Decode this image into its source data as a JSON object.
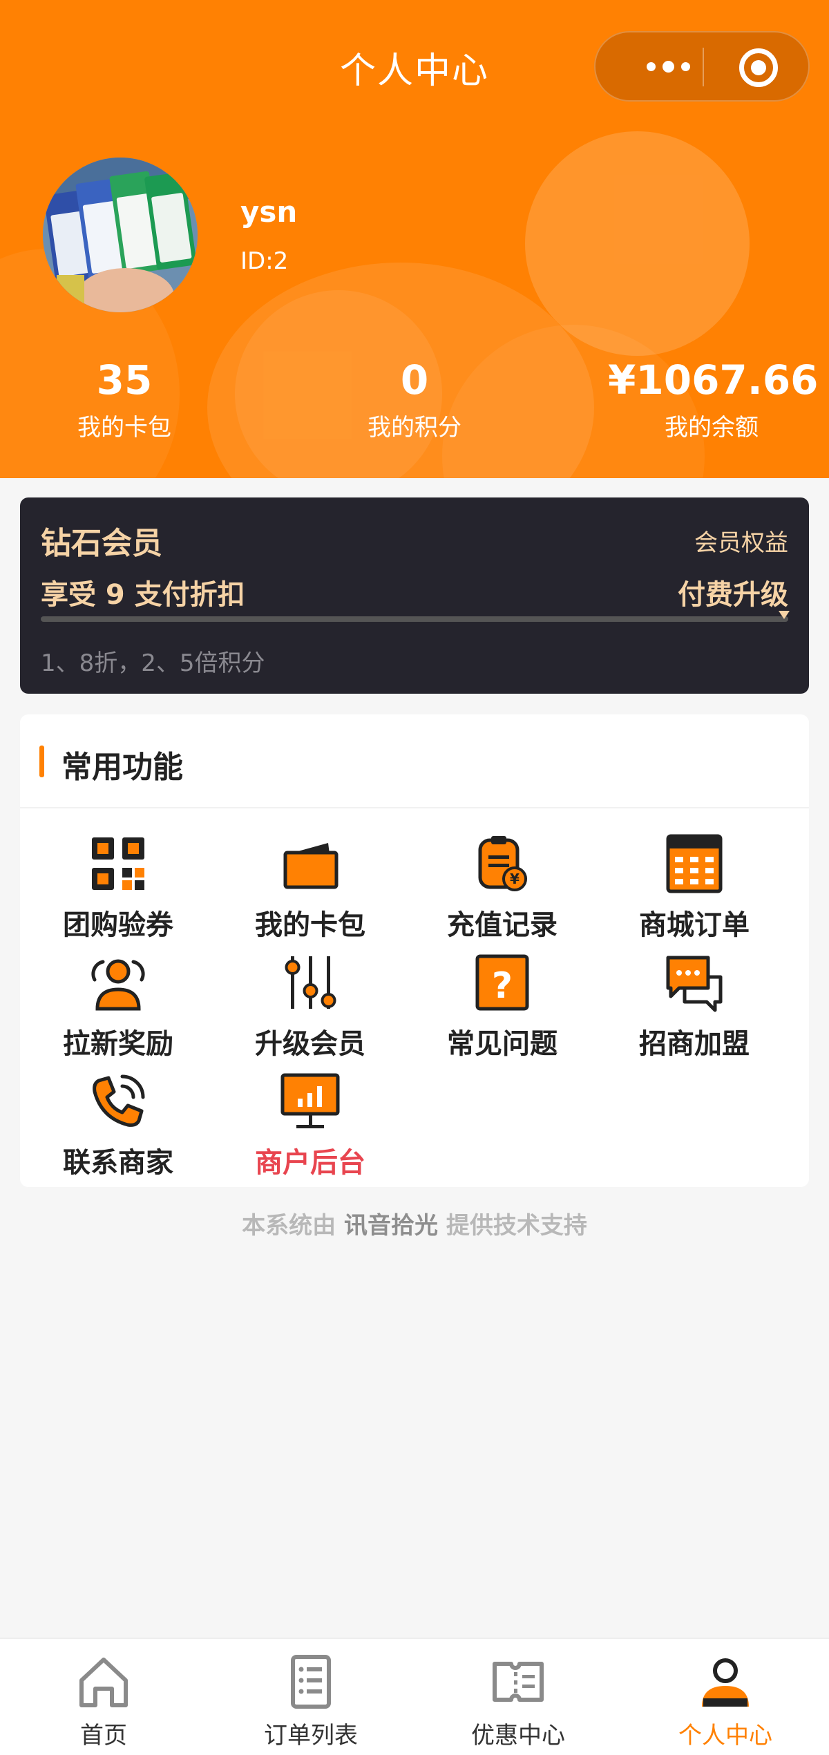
{
  "nav": {
    "title": "个人中心"
  },
  "profile": {
    "username": "ysn",
    "id_text": "ID:2"
  },
  "stats": [
    {
      "value": "35",
      "label": "我的卡包"
    },
    {
      "value": "0",
      "label": "我的积分"
    },
    {
      "value": "¥1067.66",
      "label": "我的余额"
    }
  ],
  "member": {
    "level": "钻石会员",
    "rights_link": "会员权益",
    "discount_text": "享受 9 支付折扣",
    "upgrade_link": "付费升级",
    "note": "1、8折，2、5倍积分"
  },
  "functions": {
    "title": "常用功能",
    "items": [
      {
        "label": "团购验券",
        "icon": "qr-code-icon"
      },
      {
        "label": "我的卡包",
        "icon": "wallet-icon"
      },
      {
        "label": "充值记录",
        "icon": "recharge-record-icon"
      },
      {
        "label": "商城订单",
        "icon": "calendar-order-icon"
      },
      {
        "label": "拉新奖励",
        "icon": "user-reward-icon"
      },
      {
        "label": "升级会员",
        "icon": "sliders-icon"
      },
      {
        "label": "常见问题",
        "icon": "question-icon"
      },
      {
        "label": "招商加盟",
        "icon": "chat-bubble-icon"
      },
      {
        "label": "联系商家",
        "icon": "phone-icon"
      },
      {
        "label": "商户后台",
        "icon": "monitor-chart-icon"
      }
    ]
  },
  "footer": {
    "prefix": "本系统由",
    "brand": "讯音拾光",
    "suffix": "提供技术支持"
  },
  "tabbar": [
    {
      "label": "首页",
      "icon": "home-icon",
      "active": false
    },
    {
      "label": "订单列表",
      "icon": "order-list-icon",
      "active": false
    },
    {
      "label": "优惠中心",
      "icon": "coupon-icon",
      "active": false
    },
    {
      "label": "个人中心",
      "icon": "person-icon",
      "active": true
    }
  ],
  "colors": {
    "brand_orange": "#ff8103",
    "member_card_bg": "#25242d",
    "member_gold": "#f6d3a6",
    "highlight_red": "#e8454f"
  }
}
